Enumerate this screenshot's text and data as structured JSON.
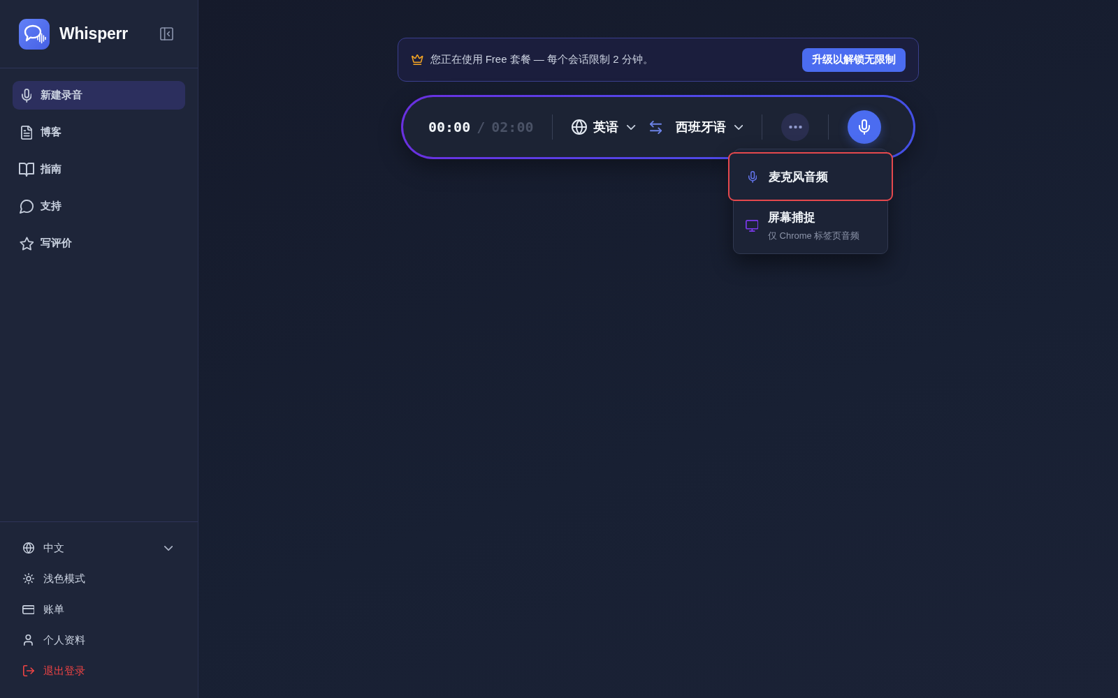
{
  "sidebar": {
    "brand": "Whisperr",
    "nav_items": [
      {
        "label": "新建录音",
        "selected": true
      },
      {
        "label": "博客",
        "selected": false
      },
      {
        "label": "指南",
        "selected": false
      },
      {
        "label": "支持",
        "selected": false
      },
      {
        "label": "写评价",
        "selected": false
      }
    ],
    "footer_items": [
      {
        "kind": "dropdown",
        "label": "中文"
      },
      {
        "kind": "link",
        "label": "浅色模式"
      },
      {
        "kind": "link",
        "label": "账单"
      },
      {
        "kind": "link",
        "label": "个人资料"
      },
      {
        "kind": "danger",
        "label": "退出登录"
      }
    ]
  },
  "plan_banner": {
    "message": "您正在使用 Free 套餐 — 每个会话限制 2 分钟。",
    "button": "升级以解锁无限制"
  },
  "recorder": {
    "elapsed": "00:00",
    "separator": "/",
    "limit": "02:00",
    "source_language": "英语",
    "target_language": "西班牙语",
    "source_menu": {
      "expanded": true,
      "items": [
        {
          "title": "麦克风音频",
          "selected": true
        },
        {
          "title": "屏幕捕捉",
          "subtitle": "仅 Chrome 标签页音频",
          "selected": false
        }
      ]
    }
  }
}
